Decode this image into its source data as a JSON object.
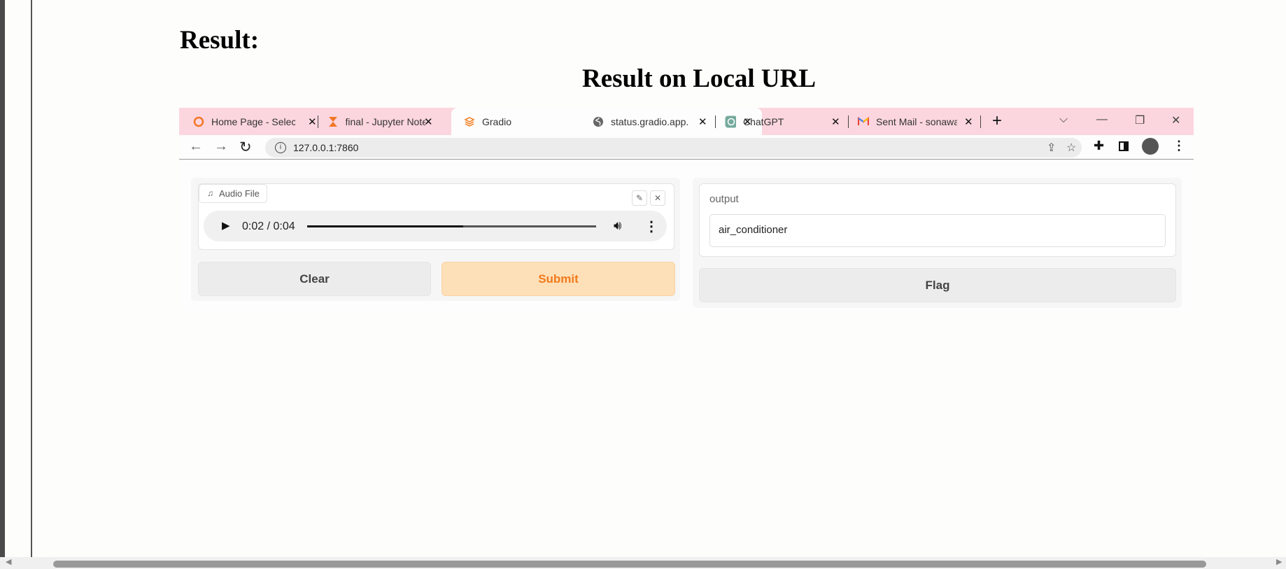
{
  "doc": {
    "result_heading": "Result:",
    "subtitle": "Result on Local URL"
  },
  "browser": {
    "tabs": [
      {
        "label": "Home Page - Select",
        "icon": "orange-ring-icon",
        "close": "✕"
      },
      {
        "label": "final - Jupyter Note",
        "icon": "hourglass-icon",
        "close": "✕"
      },
      {
        "label": "Gradio",
        "icon": "gradio-icon",
        "close": "✕"
      },
      {
        "label": "status.gradio.app.",
        "icon": "globe-icon",
        "close": "✕"
      },
      {
        "label": "ChatGPT",
        "icon": "chatgpt-icon",
        "close": "✕"
      },
      {
        "label": "Sent Mail - sonawa",
        "icon": "gmail-icon",
        "close": "✕"
      }
    ],
    "new_tab": "+",
    "url": "127.0.0.1:7860"
  },
  "app": {
    "audio_label": "Audio File",
    "player": {
      "time": "0:02 / 0:04",
      "progress": 0.54
    },
    "clear_label": "Clear",
    "submit_label": "Submit",
    "output_label": "output",
    "output_value": "air_conditioner",
    "flag_label": "Flag"
  },
  "colors": {
    "tab_strip": "#fcd6de",
    "submit_bg": "#fde0b8",
    "submit_text": "#f07a1b"
  }
}
